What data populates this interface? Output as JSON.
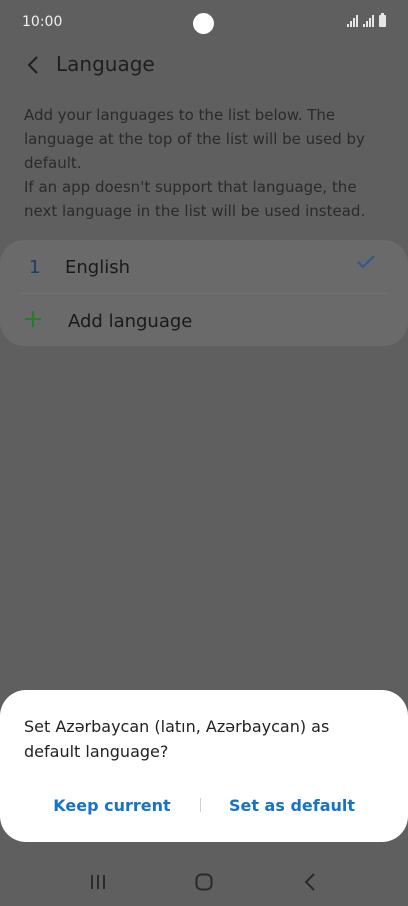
{
  "status_bar": {
    "time": "10:00"
  },
  "header": {
    "title": "Language"
  },
  "description": {
    "line1": "Add your languages to the list below. The language at the top of the list will be used by default.",
    "line2": "If an app doesn't support that language, the next language in the list will be used instead."
  },
  "languages": [
    {
      "index": "1",
      "name": "English",
      "selected": true
    }
  ],
  "add_language": {
    "label": "Add language"
  },
  "dialog": {
    "message": "Set Azərbaycan (latın, Azərbaycan) as default language?",
    "keep_label": "Keep current",
    "set_label": "Set as default"
  },
  "colors": {
    "accent": "#1673c8",
    "check": "#2c5a8a",
    "add": "#2a7a2a",
    "scrim": "#5f5f5f"
  },
  "icons": {
    "back": "back-arrow-icon",
    "check": "check-icon",
    "add": "plus-icon",
    "recents": "recents-icon",
    "home": "home-icon",
    "nav_back": "nav-back-icon"
  }
}
